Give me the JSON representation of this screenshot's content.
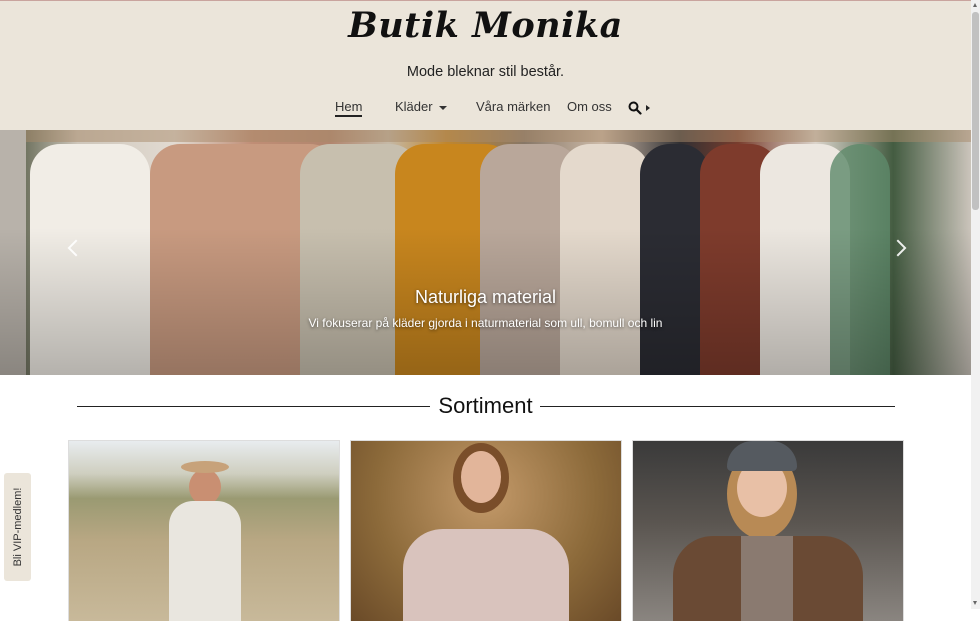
{
  "header": {
    "logo": "Butik Monika",
    "tagline": "Mode bleknar stil består."
  },
  "nav": {
    "items": [
      {
        "label": "Hem",
        "active": true
      },
      {
        "label": "Kläder",
        "dropdown": true
      },
      {
        "label": "Våra märken"
      },
      {
        "label": "Om oss"
      }
    ],
    "search_icon": "search-icon"
  },
  "hero": {
    "title": "Naturliga material",
    "subtitle": "Vi fokuserar på kläder gjorda i naturmaterial som ull, bomull och lin"
  },
  "section": {
    "title": "Sortiment"
  },
  "vip_tab": {
    "label": "Bli VIP-medlem!"
  },
  "colors": {
    "header_bg": "#ebe5da",
    "text": "#222222",
    "accent_line": "#c9a49e"
  }
}
